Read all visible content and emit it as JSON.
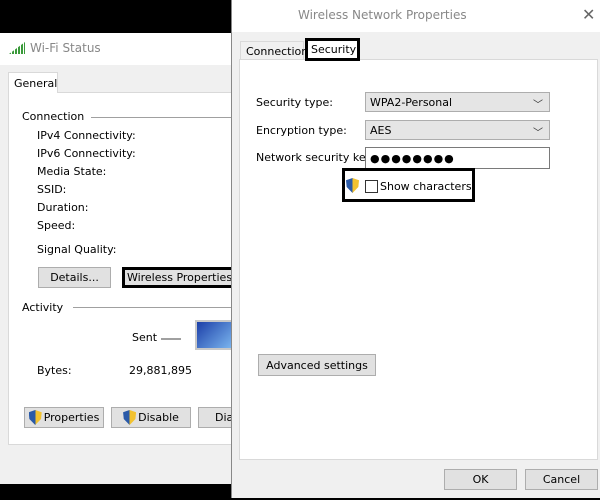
{
  "wifi_status": {
    "title": "Wi-Fi Status",
    "tab": "General",
    "connection_heading": "Connection",
    "fields": [
      "IPv4 Connectivity:",
      "IPv6 Connectivity:",
      "Media State:",
      "SSID:",
      "Duration:",
      "Speed:"
    ],
    "signal_quality": "Signal Quality:",
    "details_button": "Details...",
    "wireless_properties_button": "Wireless Properties",
    "activity_heading": "Activity",
    "sent_label": "Sent",
    "bytes_label": "Bytes:",
    "bytes_sent": "29,881,895",
    "properties_button": "Properties",
    "disable_button": "Disable",
    "diagnose_button": "Diag"
  },
  "wireless_props": {
    "title": "Wireless Network Properties",
    "tabs": [
      "Connection",
      "Security"
    ],
    "active_tab": "Security",
    "security_type_label": "Security type:",
    "security_type_value": "WPA2-Personal",
    "encryption_type_label": "Encryption type:",
    "encryption_type_value": "AES",
    "key_label": "Network security key",
    "key_value": "●●●●●●●●",
    "show_characters": "Show characters",
    "show_characters_checked": false,
    "advanced_button": "Advanced settings",
    "ok_button": "OK",
    "cancel_button": "Cancel"
  },
  "colors": {
    "signal_green": "#3a9a3a",
    "window_bg": "#f0f0f0",
    "highlight_border": "#000000"
  }
}
